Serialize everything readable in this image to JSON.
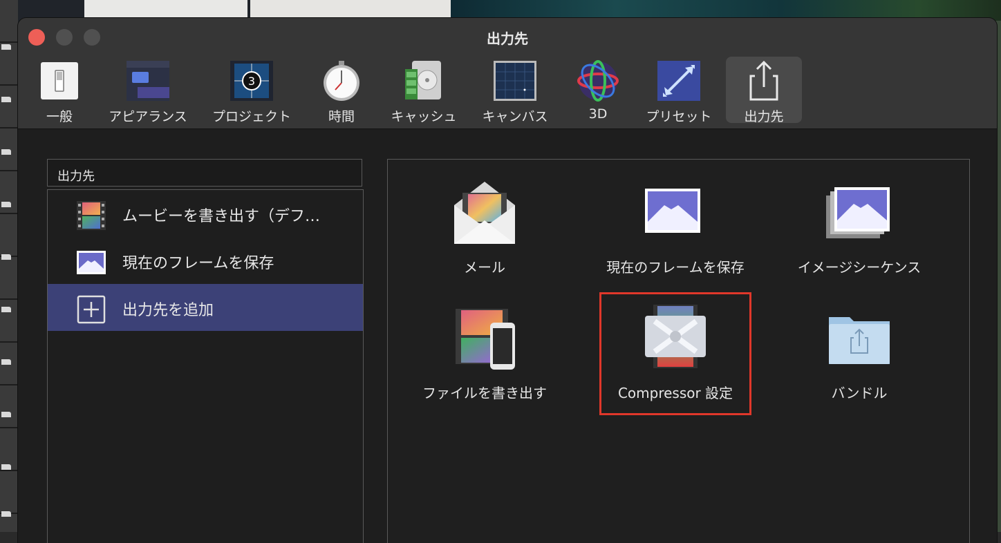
{
  "window": {
    "title": "出力先"
  },
  "toolbar": {
    "tabs": [
      {
        "label": "一般",
        "icon": "switch-icon"
      },
      {
        "label": "アピアランス",
        "icon": "appearance-icon"
      },
      {
        "label": "プロジェクト",
        "icon": "project-icon"
      },
      {
        "label": "時間",
        "icon": "stopwatch-icon"
      },
      {
        "label": "キャッシュ",
        "icon": "cache-icon"
      },
      {
        "label": "キャンバス",
        "icon": "canvas-icon"
      },
      {
        "label": "3D",
        "icon": "sphere-3d-icon"
      },
      {
        "label": "プリセット",
        "icon": "preset-icon"
      },
      {
        "label": "出力先",
        "icon": "share-icon",
        "selected": true
      }
    ]
  },
  "sidebar": {
    "header": "出力先",
    "items": [
      {
        "label": "ムービーを書き出す（デフ…",
        "icon": "film-icon"
      },
      {
        "label": "現在のフレームを保存",
        "icon": "mountain-frame-icon"
      },
      {
        "label": "出力先を追加",
        "icon": "plus-box-icon",
        "selected": true
      }
    ]
  },
  "destinations": [
    {
      "label": "メール",
      "icon": "mail-envelope-icon"
    },
    {
      "label": "現在のフレームを保存",
      "icon": "mountain-frame-icon"
    },
    {
      "label": "イメージシーケンス",
      "icon": "image-sequence-icon"
    },
    {
      "label": "ファイルを書き出す",
      "icon": "film-phone-icon"
    },
    {
      "label": "Compressor 設定",
      "icon": "compressor-icon",
      "highlighted": true
    },
    {
      "label": "バンドル",
      "icon": "bundle-folder-icon"
    }
  ],
  "colors": {
    "selection": "#3c4177",
    "highlight_border": "#e0372a",
    "close_button": "#ee5f57"
  }
}
